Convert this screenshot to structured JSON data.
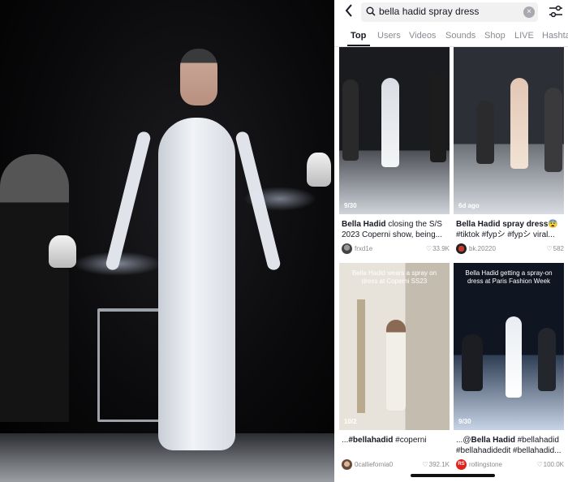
{
  "search": {
    "query": "bella hadid spray dress",
    "back_icon": "chevron-left-icon",
    "search_icon": "search-icon",
    "clear_icon": "clear-icon",
    "filter_icon": "filter-sliders-icon"
  },
  "tabs": [
    {
      "label": "Top",
      "active": true
    },
    {
      "label": "Users",
      "active": false
    },
    {
      "label": "Videos",
      "active": false
    },
    {
      "label": "Sounds",
      "active": false
    },
    {
      "label": "Shop",
      "active": false
    },
    {
      "label": "LIVE",
      "active": false
    },
    {
      "label": "Hashta",
      "active": false
    }
  ],
  "videos": [
    {
      "badge": "9/30",
      "overlay": "",
      "caption_bold": "Bella Hadid",
      "caption_rest": " closing the S/S 2023 Coperni show, being...",
      "author": "frxd1e",
      "likes": "33.9K"
    },
    {
      "badge": "6d ago",
      "overlay": "",
      "caption_bold": "Bella Hadid spray dress",
      "caption_emoji": "😨",
      "caption_rest": " #tiktok #fypシ #fypシ viral...",
      "author": "bk.20220",
      "likes": "582"
    },
    {
      "badge": "10/2",
      "overlay": "Bella Hadid wears a spray on dress at Coperni SS23",
      "caption_prefix": "...",
      "caption_bold": "#bellahadid",
      "caption_rest": " #coperni",
      "author": "0calliefornia0",
      "likes": "392.1K"
    },
    {
      "badge": "9/30",
      "overlay": "Bella Hadid getting a spray-on dress at Paris Fashion Week",
      "caption_prefix": "...@",
      "caption_bold": "Bella Hadid",
      "caption_rest": " #bellahadid #bellahadidedit #bellahadid...",
      "author": "rollingstone",
      "likes": "100.0K"
    }
  ],
  "colors": {
    "text_primary": "#161823",
    "text_secondary": "#8a8b91",
    "search_bg": "#f1f1f2"
  }
}
